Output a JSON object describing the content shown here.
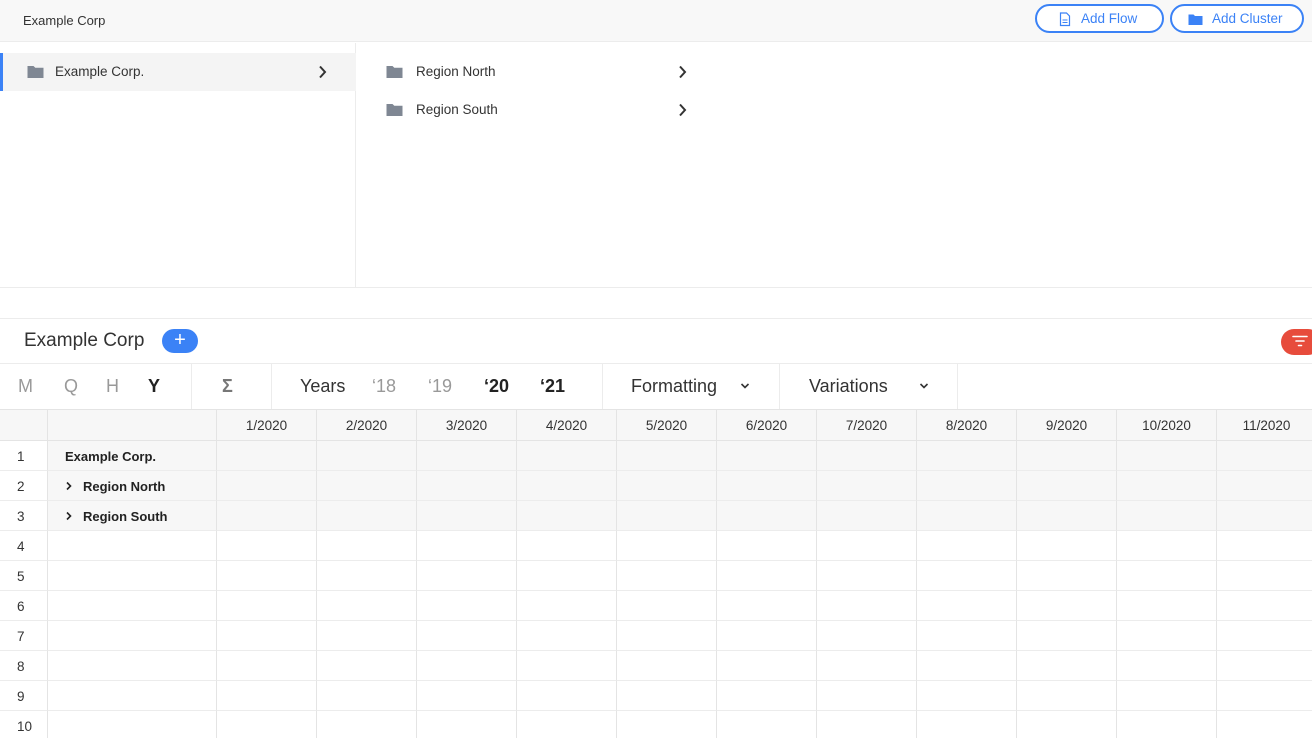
{
  "app": {
    "title": "Example Corp"
  },
  "actions": {
    "add_flow": "Add Flow",
    "add_cluster": "Add Cluster"
  },
  "browser": {
    "left_items": [
      {
        "label": "Example Corp."
      }
    ],
    "right_items": [
      {
        "label": "Region North"
      },
      {
        "label": "Region South"
      }
    ]
  },
  "sheet": {
    "title": "Example Corp",
    "add_label": "+",
    "granularity": [
      "M",
      "Q",
      "H",
      "Y"
    ],
    "active_granularity": "Y",
    "sum_symbol": "Σ",
    "years_label": "Years",
    "years": [
      "‘18",
      "‘19",
      "‘20",
      "‘21"
    ],
    "active_years": [
      "‘20",
      "‘21"
    ],
    "formatting_label": "Formatting",
    "variations_label": "Variations"
  },
  "colors": {
    "accent": "#3b82f6",
    "filter": "#e74c3c"
  },
  "grid": {
    "columns": [
      "1/2020",
      "2/2020",
      "3/2020",
      "4/2020",
      "5/2020",
      "6/2020",
      "7/2020",
      "8/2020",
      "9/2020",
      "10/2020",
      "11/2020"
    ],
    "rows": [
      {
        "num": "1",
        "label": "Example Corp.",
        "expandable": false
      },
      {
        "num": "2",
        "label": "Region North",
        "expandable": true
      },
      {
        "num": "3",
        "label": "Region South",
        "expandable": true
      },
      {
        "num": "4",
        "label": ""
      },
      {
        "num": "5",
        "label": ""
      },
      {
        "num": "6",
        "label": ""
      },
      {
        "num": "7",
        "label": ""
      },
      {
        "num": "8",
        "label": ""
      },
      {
        "num": "9",
        "label": ""
      },
      {
        "num": "10",
        "label": ""
      }
    ]
  }
}
